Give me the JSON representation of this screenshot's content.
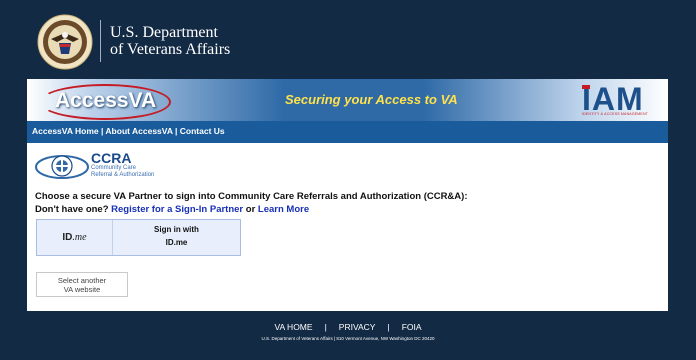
{
  "header": {
    "title_line1": "U.S. Department",
    "title_line2": "of Veterans Affairs"
  },
  "banner": {
    "logo_text": "AccessVA",
    "tagline": "Securing your Access to VA",
    "iam_text": "IAM",
    "iam_subtext": "IDENTITY & ACCESS MANAGEMENT"
  },
  "nav": {
    "home": "AccessVA Home",
    "sep1": " | ",
    "about": "About AccessVA",
    "sep2": " | ",
    "contact": "Contact Us"
  },
  "app": {
    "name": "CCRA",
    "sub1": "Community Care",
    "sub2": "Referral & Authorization"
  },
  "prompt": {
    "choose": "Choose a secure VA Partner to sign into Community Care Referrals and Authorization (CCR&A):",
    "no_account": "Don't have one? ",
    "register_link": "Register for a Sign-In Partner",
    "or": " or ",
    "learn_link": "Learn More"
  },
  "idme": {
    "logo_bold": "ID",
    "logo_italic": ".me",
    "line1": "Sign in with",
    "line2": "ID.me"
  },
  "other": {
    "line1": "Select another",
    "line2": "VA website"
  },
  "footer": {
    "home": "VA HOME",
    "privacy": "PRIVACY",
    "foia": "FOIA",
    "sep": "|",
    "address": "U.S. Department of Veterans Affairs | 810 Vermont Avenue, NW Washington DC 20420"
  },
  "colors": {
    "background": "#132a44",
    "nav": "#1a5b9c",
    "tagline": "#ffe14a",
    "link": "#1730b8"
  }
}
